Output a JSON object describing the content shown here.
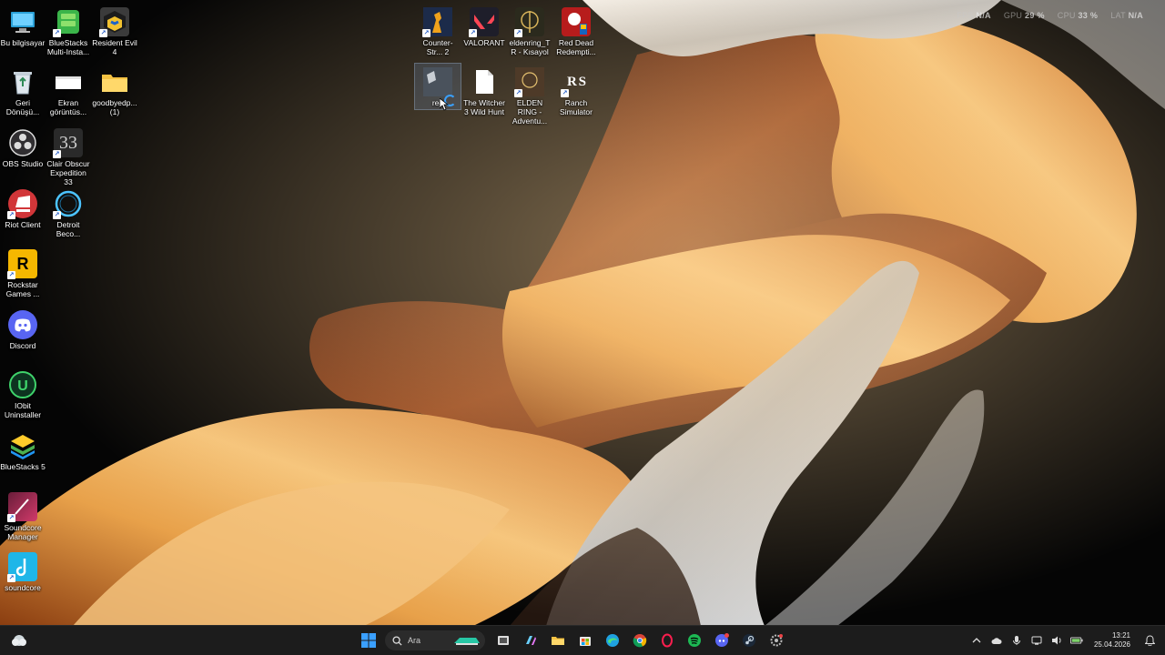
{
  "desktop": {
    "icons": [
      {
        "label": "Bu bilgisayar"
      },
      {
        "label": "BlueStacks Multi-Insta..."
      },
      {
        "label": "Resident Evil 4"
      },
      {
        "label": "Geri Dönüşü..."
      },
      {
        "label": "Ekran görüntüs..."
      },
      {
        "label": "goodbyedp... (1)"
      },
      {
        "label": "OBS Studio"
      },
      {
        "label": "Clair Obscur Expedition 33"
      },
      {
        "label": "Riot Client"
      },
      {
        "label": "Detroit Beco..."
      },
      {
        "label": "Rockstar Games ..."
      },
      {
        "label": "Discord"
      },
      {
        "label": "IObit Uninstaller"
      },
      {
        "label": "BlueStacks 5"
      },
      {
        "label": "Soundcore Manager"
      },
      {
        "label": "soundcore"
      },
      {
        "label": "Counter-Str... 2"
      },
      {
        "label": "VALORANT"
      },
      {
        "label": "eldenring_TR - Kısayol"
      },
      {
        "label": "Red Dead Redempti..."
      },
      {
        "label": "re4"
      },
      {
        "label": "The Witcher 3 Wild Hunt"
      },
      {
        "label": "ELDEN RING - Adventu..."
      },
      {
        "label": "Ranch Simulator"
      }
    ],
    "icon_glyphs": {
      "clair": "33",
      "rockstar": "R",
      "rs": "R S",
      "iobit": "U"
    }
  },
  "overlay": {
    "fps_label": "FPS",
    "fps_value": "N/A",
    "gpu_label": "GPU",
    "gpu_value": "29 %",
    "cpu_label": "CPU",
    "cpu_value": "33 %",
    "lat_label": "LAT",
    "lat_value": "N/A"
  },
  "taskbar": {
    "search_placeholder": "Ara",
    "time": "13:21",
    "date": "25.04.2026",
    "pinned": [
      "windows-start",
      "search",
      "game",
      "task-view",
      "copilot",
      "file-explorer",
      "microsoft-store",
      "edge",
      "chrome",
      "opera-gx",
      "spotify",
      "discord",
      "steam",
      "settings"
    ]
  },
  "colors": {
    "taskbar_bg": "#1c1c1c",
    "accent_blue": "#3aa0ff",
    "silk_orange": "#e59a3a",
    "silk_brown": "#6b2a12",
    "silk_white": "#d8d8d8"
  }
}
